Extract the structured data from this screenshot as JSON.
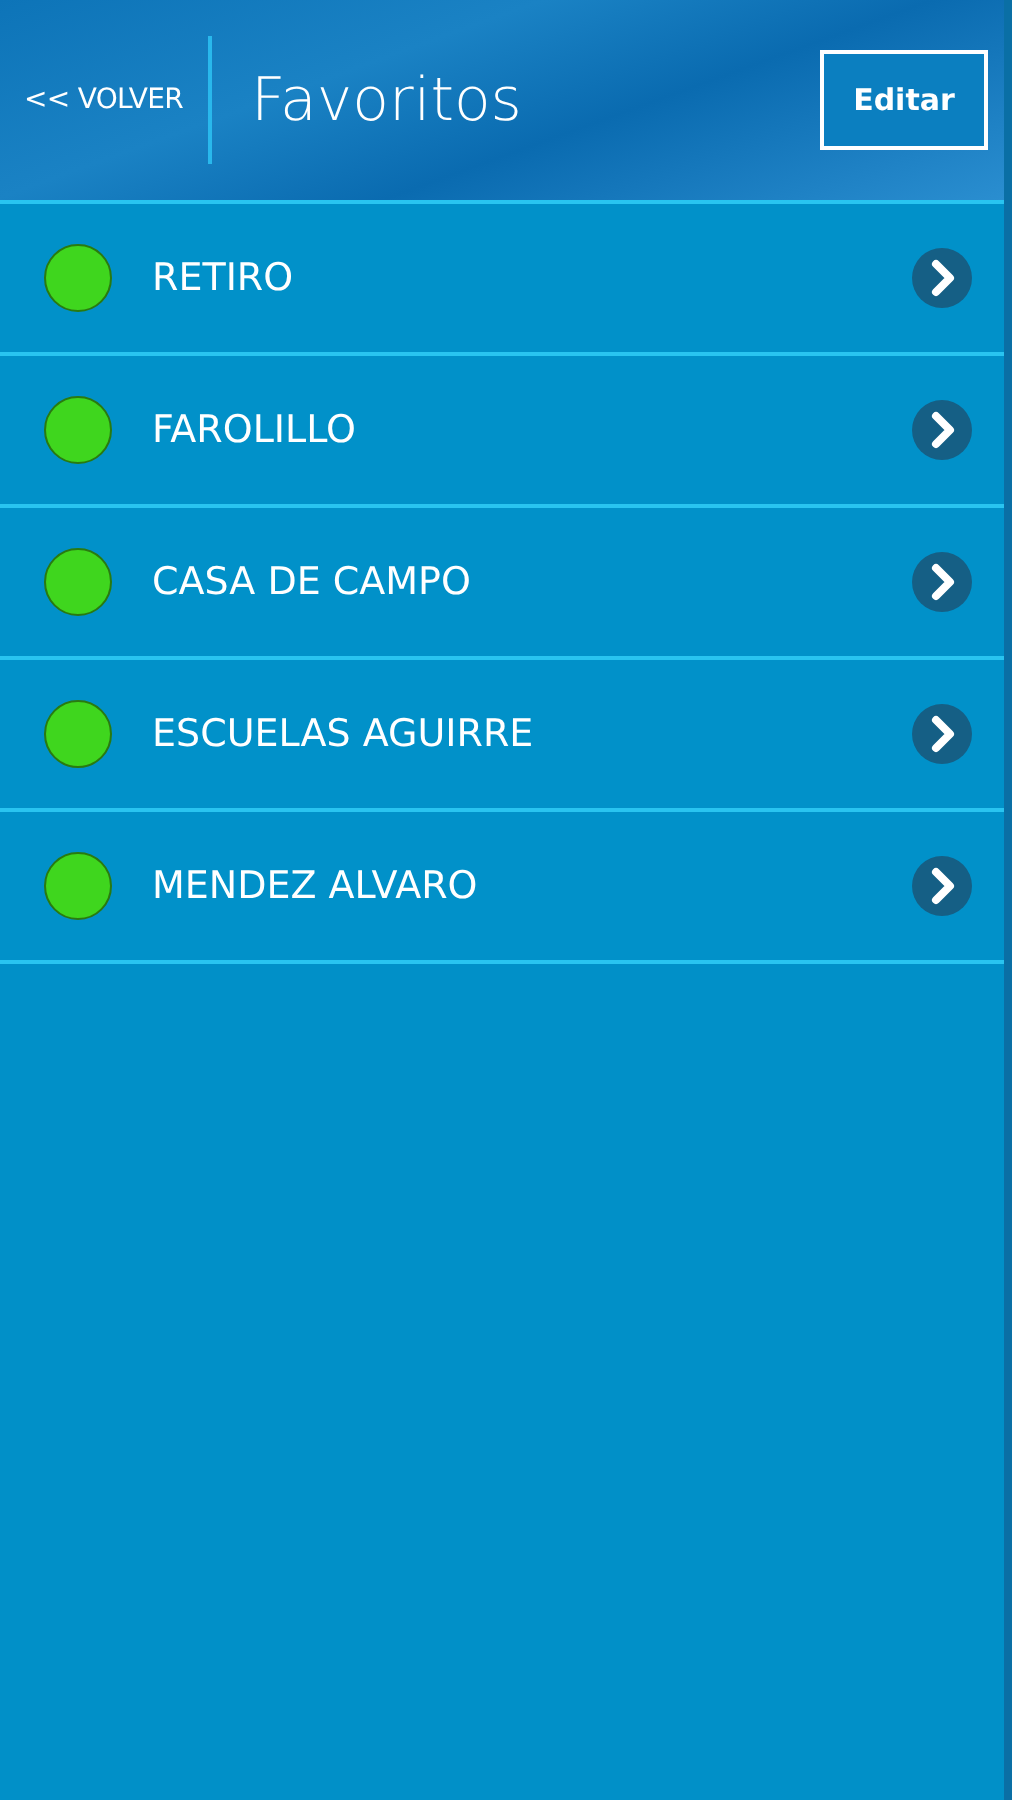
{
  "header": {
    "back": "<< VOLVER",
    "title": "Favoritos",
    "edit": "Editar"
  },
  "favorites": [
    {
      "name": "RETIRO",
      "color": "#3fd61e"
    },
    {
      "name": "FAROLILLO",
      "color": "#3fd61e"
    },
    {
      "name": "CASA DE CAMPO",
      "color": "#3fd61e"
    },
    {
      "name": "ESCUELAS AGUIRRE",
      "color": "#3fd61e"
    },
    {
      "name": "MENDEZ ALVARO",
      "color": "#3fd61e"
    }
  ]
}
